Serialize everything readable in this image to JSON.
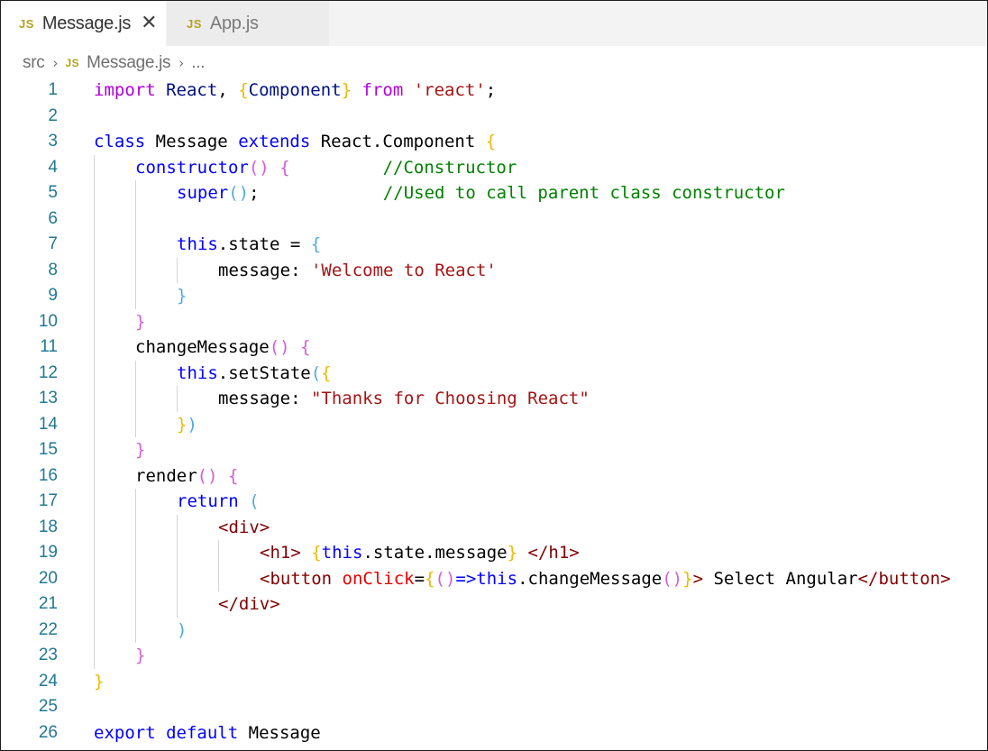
{
  "tabs": [
    {
      "badge": "JS",
      "label": "Message.js",
      "active": true,
      "close": "✕"
    },
    {
      "badge": "JS",
      "label": "App.js",
      "active": false
    }
  ],
  "breadcrumb": {
    "folder": "src",
    "separator": "›",
    "file_badge": "JS",
    "file": "Message.js",
    "more": "..."
  },
  "colors": {
    "keyword": "#0000ff",
    "control_keyword": "#af00db",
    "string": "#a31515",
    "comment": "#008000",
    "line_number": "#237893",
    "bracket_level1": "#f0b800",
    "bracket_level2": "#d65cd6",
    "bracket_level3": "#4fa8e8"
  },
  "code_lines": [
    {
      "n": "1",
      "indent": 0,
      "tokens": [
        [
          "kf",
          "import"
        ],
        [
          "plain",
          " "
        ],
        [
          "var",
          "React"
        ],
        [
          "plain",
          ", "
        ],
        [
          "b1",
          "{"
        ],
        [
          "var",
          "Component"
        ],
        [
          "b1",
          "}"
        ],
        [
          "plain",
          " "
        ],
        [
          "kf",
          "from"
        ],
        [
          "plain",
          " "
        ],
        [
          "str",
          "'react'"
        ],
        [
          "plain",
          ";"
        ]
      ]
    },
    {
      "n": "2",
      "indent": 0,
      "tokens": []
    },
    {
      "n": "3",
      "indent": 0,
      "tokens": [
        [
          "kw",
          "class"
        ],
        [
          "plain",
          " "
        ],
        [
          "plain",
          "Message"
        ],
        [
          "plain",
          " "
        ],
        [
          "kw",
          "extends"
        ],
        [
          "plain",
          " "
        ],
        [
          "plain",
          "React.Component"
        ],
        [
          "plain",
          " "
        ],
        [
          "b1",
          "{"
        ]
      ]
    },
    {
      "n": "4",
      "indent": 1,
      "tokens": [
        [
          "kw",
          "constructor"
        ],
        [
          "b2",
          "()"
        ],
        [
          "plain",
          " "
        ],
        [
          "b2",
          "{"
        ],
        [
          "plain",
          "         "
        ],
        [
          "cm",
          "//Constructor"
        ]
      ]
    },
    {
      "n": "5",
      "indent": 2,
      "tokens": [
        [
          "kw",
          "super"
        ],
        [
          "b3",
          "()"
        ],
        [
          "plain",
          ";            "
        ],
        [
          "cm",
          "//Used to call parent class constructor"
        ]
      ]
    },
    {
      "n": "6",
      "indent": 2,
      "tokens": []
    },
    {
      "n": "7",
      "indent": 2,
      "tokens": [
        [
          "kw",
          "this"
        ],
        [
          "plain",
          ".state = "
        ],
        [
          "b3",
          "{"
        ]
      ]
    },
    {
      "n": "8",
      "indent": 3,
      "tokens": [
        [
          "plain",
          "message: "
        ],
        [
          "str",
          "'Welcome to React'"
        ]
      ]
    },
    {
      "n": "9",
      "indent": 2,
      "tokens": [
        [
          "b3",
          "}"
        ]
      ]
    },
    {
      "n": "10",
      "indent": 1,
      "tokens": [
        [
          "b2",
          "}"
        ]
      ]
    },
    {
      "n": "11",
      "indent": 1,
      "tokens": [
        [
          "plain",
          "changeMessage"
        ],
        [
          "b2",
          "()"
        ],
        [
          "plain",
          " "
        ],
        [
          "b2",
          "{"
        ]
      ]
    },
    {
      "n": "12",
      "indent": 2,
      "tokens": [
        [
          "kw",
          "this"
        ],
        [
          "plain",
          ".setState"
        ],
        [
          "b3",
          "("
        ],
        [
          "b1",
          "{"
        ]
      ]
    },
    {
      "n": "13",
      "indent": 3,
      "tokens": [
        [
          "plain",
          "message: "
        ],
        [
          "str",
          "\"Thanks for Choosing React\""
        ]
      ]
    },
    {
      "n": "14",
      "indent": 2,
      "tokens": [
        [
          "b1",
          "}"
        ],
        [
          "b3",
          ")"
        ]
      ]
    },
    {
      "n": "15",
      "indent": 1,
      "tokens": [
        [
          "b2",
          "}"
        ]
      ]
    },
    {
      "n": "16",
      "indent": 1,
      "tokens": [
        [
          "plain",
          "render"
        ],
        [
          "b2",
          "()"
        ],
        [
          "plain",
          " "
        ],
        [
          "b2",
          "{"
        ]
      ]
    },
    {
      "n": "17",
      "indent": 2,
      "tokens": [
        [
          "kw",
          "return"
        ],
        [
          "plain",
          " "
        ],
        [
          "b3",
          "("
        ]
      ]
    },
    {
      "n": "18",
      "indent": 3,
      "tokens": [
        [
          "tag",
          "<div>"
        ]
      ]
    },
    {
      "n": "19",
      "indent": 4,
      "tokens": [
        [
          "tag",
          "<h1>"
        ],
        [
          "plain",
          " "
        ],
        [
          "b1",
          "{"
        ],
        [
          "kw",
          "this"
        ],
        [
          "plain",
          ".state.message"
        ],
        [
          "b1",
          "}"
        ],
        [
          "plain",
          " "
        ],
        [
          "tag",
          "</h1>"
        ]
      ]
    },
    {
      "n": "20",
      "indent": 4,
      "tokens": [
        [
          "tag",
          "<button"
        ],
        [
          "plain",
          " "
        ],
        [
          "attr",
          "onClick"
        ],
        [
          "plain",
          "="
        ],
        [
          "b1",
          "{"
        ],
        [
          "b2",
          "()"
        ],
        [
          "kw",
          "=>"
        ],
        [
          "kw",
          "this"
        ],
        [
          "plain",
          ".changeMessage"
        ],
        [
          "b2",
          "()"
        ],
        [
          "b1",
          "}"
        ],
        [
          "tag",
          ">"
        ],
        [
          "plain",
          " Select Angular"
        ],
        [
          "tag",
          "</button>"
        ]
      ]
    },
    {
      "n": "21",
      "indent": 3,
      "tokens": [
        [
          "tag",
          "</div>"
        ]
      ]
    },
    {
      "n": "22",
      "indent": 2,
      "tokens": [
        [
          "b3",
          ")"
        ]
      ]
    },
    {
      "n": "23",
      "indent": 1,
      "tokens": [
        [
          "b2",
          "}"
        ]
      ]
    },
    {
      "n": "24",
      "indent": 0,
      "tokens": [
        [
          "b1",
          "}"
        ]
      ]
    },
    {
      "n": "25",
      "indent": 0,
      "tokens": []
    },
    {
      "n": "26",
      "indent": 0,
      "tokens": [
        [
          "kw",
          "export"
        ],
        [
          "plain",
          " "
        ],
        [
          "kw",
          "default"
        ],
        [
          "plain",
          " "
        ],
        [
          "plain",
          "Message"
        ]
      ]
    }
  ]
}
